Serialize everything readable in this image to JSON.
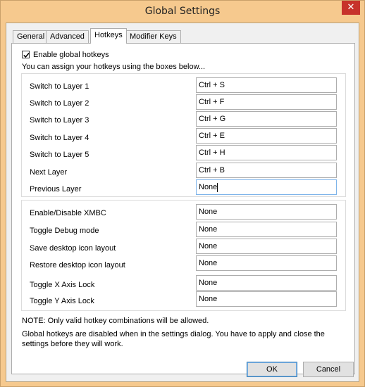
{
  "window": {
    "title": "Global Settings",
    "close_glyph": "✕"
  },
  "tabs": [
    {
      "label": "General",
      "active": false
    },
    {
      "label": "Advanced",
      "active": false
    },
    {
      "label": "Hotkeys",
      "active": true
    },
    {
      "label": "Modifier Keys",
      "active": false
    }
  ],
  "enable": {
    "label": "Enable global hotkeys",
    "checked": true
  },
  "intro_text": "You can assign your hotkeys using the boxes below...",
  "group_layers": [
    {
      "label": "Switch to Layer 1",
      "value": "Ctrl + S"
    },
    {
      "label": "Switch to Layer 2",
      "value": "Ctrl + F"
    },
    {
      "label": "Switch to Layer 3",
      "value": "Ctrl + G"
    },
    {
      "label": "Switch to Layer 4",
      "value": "Ctrl + E"
    },
    {
      "label": "Switch to Layer 5",
      "value": "Ctrl + H"
    },
    {
      "label": "Next Layer",
      "value": "Ctrl + B"
    },
    {
      "label": "Previous Layer",
      "value": "None"
    }
  ],
  "group_misc": [
    {
      "label": "Enable/Disable XMBC",
      "value": "None"
    },
    {
      "label": "Toggle Debug mode",
      "value": "None"
    },
    {
      "label": "Save desktop icon layout",
      "value": "None"
    },
    {
      "label": "Restore desktop icon layout",
      "value": "None"
    },
    {
      "label": "Toggle X Axis Lock",
      "value": "None"
    },
    {
      "label": "Toggle Y Axis Lock",
      "value": "None"
    }
  ],
  "notes": {
    "note1": "NOTE: Only valid hotkey combinations will be allowed.",
    "note2": "Global hotkeys are disabled when in the settings dialog. You have to apply and close the",
    "note3": "settings before they will work."
  },
  "buttons": {
    "ok": "OK",
    "cancel": "Cancel"
  },
  "colors": {
    "close": "#c7322b",
    "frame": "#f6c98e",
    "focus_border": "#7eb4ea"
  }
}
